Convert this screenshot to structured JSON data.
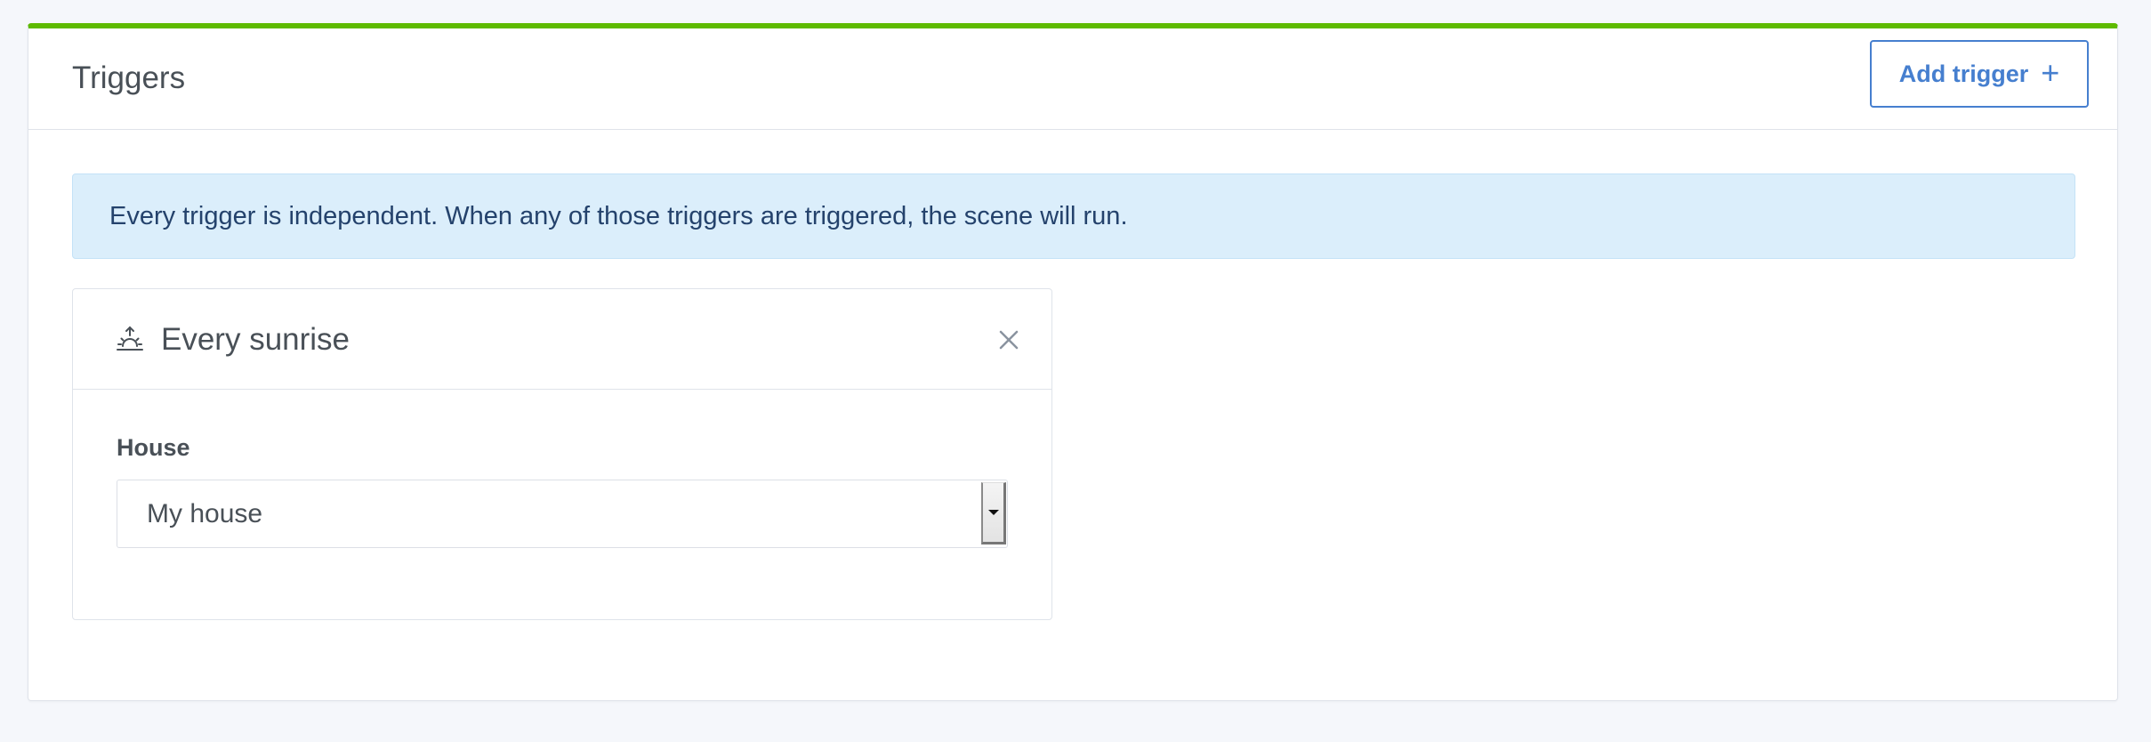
{
  "card": {
    "title": "Triggers",
    "add_button_label": "Add trigger",
    "add_button_icon": "plus-icon"
  },
  "alert": {
    "text": "Every trigger is independent. When any of those triggers are triggered, the scene will run."
  },
  "trigger": {
    "icon": "sunrise-icon",
    "title": "Every sunrise",
    "close_icon": "close-icon",
    "field_label": "House",
    "select_value": "My house"
  },
  "colors": {
    "accent_green": "#5eba00",
    "primary_blue": "#467fcf",
    "alert_bg": "#dbeefb",
    "alert_text": "#24426c"
  }
}
